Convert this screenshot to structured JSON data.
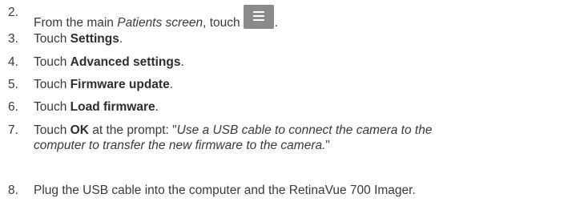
{
  "steps": [
    {
      "number": "2.",
      "prefix": "From the main ",
      "italic": "Patients screen",
      "mid": ", touch",
      "icon": "menu-icon",
      "suffix": "."
    },
    {
      "number": "3.",
      "pre": "Touch ",
      "bold": "Settings",
      "post": "."
    },
    {
      "number": "4.",
      "pre": "Touch ",
      "bold": "Advanced settings",
      "post": "."
    },
    {
      "number": "5.",
      "pre": "Touch ",
      "bold": "Firmware update",
      "post": "."
    },
    {
      "number": "6.",
      "pre": "Touch ",
      "bold": "Load firmware",
      "post": "."
    },
    {
      "number": "7.",
      "pre": "Touch ",
      "bold": "OK",
      "post": " at the prompt: \"",
      "italic_line1": "Use a USB cable to connect the camera to the",
      "italic_line2": "computer to transfer the new firmware to the camera.",
      "close": "\""
    },
    {
      "number": "8.",
      "text": "Plug the USB cable into the computer and the RetinaVue 700 Imager."
    }
  ]
}
